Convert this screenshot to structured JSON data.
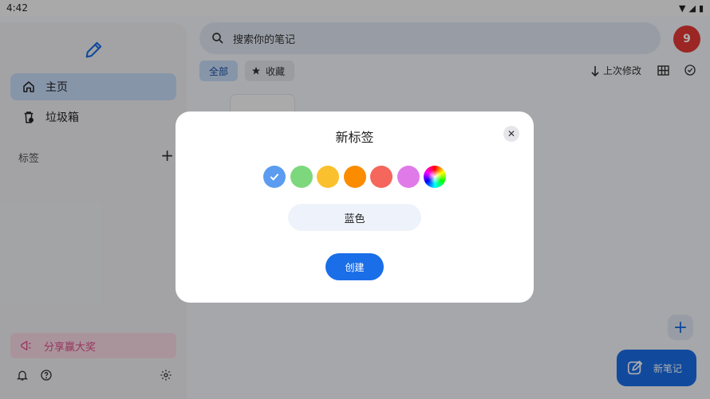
{
  "status_bar": {
    "time": "4:42"
  },
  "sidebar": {
    "items": [
      {
        "label": "主页",
        "icon": "home-icon"
      },
      {
        "label": "垃圾箱",
        "icon": "trash-icon"
      }
    ],
    "tags_header": "标签",
    "share_label": "分享赢大奖"
  },
  "search": {
    "placeholder": "搜索你的笔记"
  },
  "avatar": {
    "badge": "9"
  },
  "filters": {
    "all": "全部",
    "favorites": "收藏"
  },
  "sort": {
    "label": "上次修改"
  },
  "new_note": {
    "label": "新笔记"
  },
  "dialog": {
    "title": "新标签",
    "name_value": "蓝色",
    "create_label": "创建",
    "colors": [
      "#5b9cf0",
      "#7dd87d",
      "#fbc02d",
      "#fb8c00",
      "#f5665c",
      "#e07ae8"
    ],
    "selected_color": "#5b9cf0"
  },
  "colors": {
    "accent": "#1a6ee8",
    "badge": "#e53935",
    "share": "#e04c8a"
  }
}
